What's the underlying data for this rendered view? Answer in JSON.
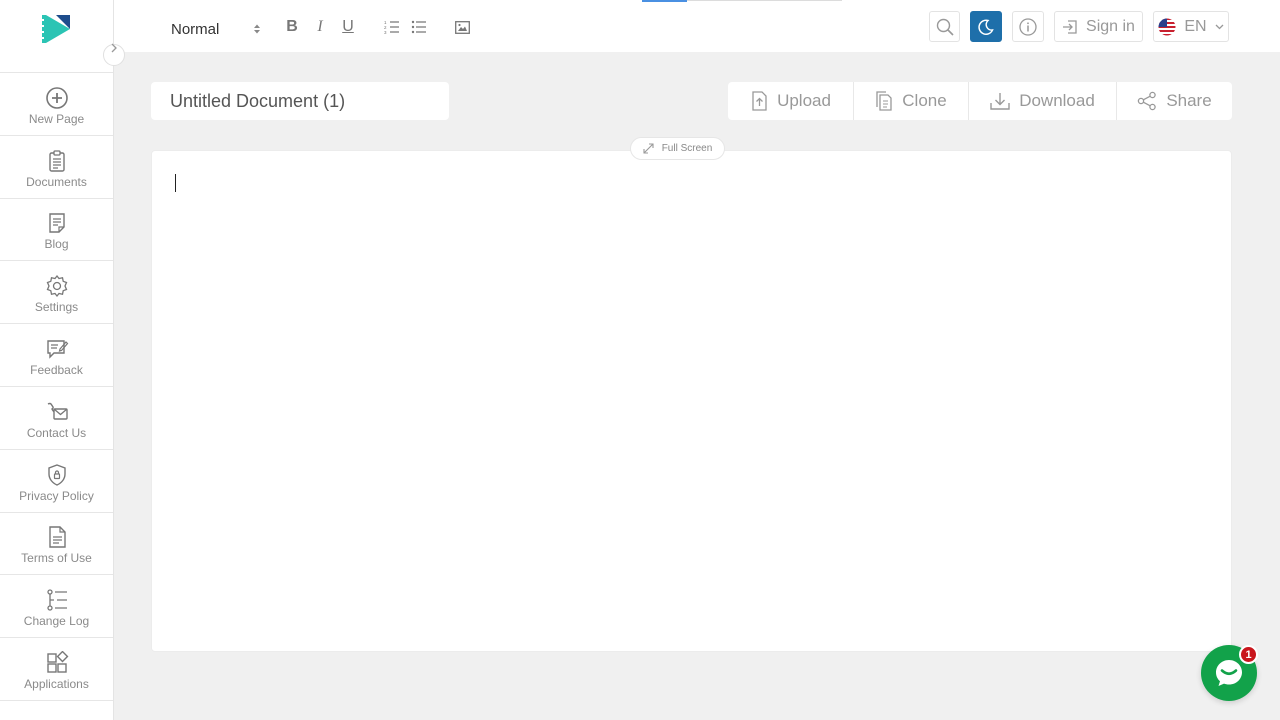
{
  "sidebar": {
    "items": [
      {
        "label": "New Page",
        "icon": "plus-circle-icon"
      },
      {
        "label": "Documents",
        "icon": "clipboard-icon"
      },
      {
        "label": "Blog",
        "icon": "blog-icon"
      },
      {
        "label": "Settings",
        "icon": "gear-icon"
      },
      {
        "label": "Feedback",
        "icon": "feedback-icon"
      },
      {
        "label": "Contact Us",
        "icon": "contact-icon"
      },
      {
        "label": "Privacy Policy",
        "icon": "shield-icon"
      },
      {
        "label": "Terms of Use",
        "icon": "document-icon"
      },
      {
        "label": "Change Log",
        "icon": "list-icon"
      },
      {
        "label": "Applications",
        "icon": "apps-icon"
      }
    ]
  },
  "toolbar": {
    "format_value": "Normal",
    "bold": "B",
    "italic": "I",
    "underline": "U"
  },
  "header": {
    "signin_label": "Sign in",
    "lang_label": "EN"
  },
  "document": {
    "title": "Untitled Document (1)"
  },
  "actions": {
    "upload": "Upload",
    "clone": "Clone",
    "download": "Download",
    "share": "Share"
  },
  "editor": {
    "fullscreen_label": "Full Screen"
  },
  "chat": {
    "badge_count": "1"
  },
  "colors": {
    "accent_dark": "#1e6faa",
    "chat_green": "#12a24a",
    "badge_red": "#c9161d",
    "logo_teal": "#2bc4b4",
    "logo_blue": "#1e4d8c"
  }
}
